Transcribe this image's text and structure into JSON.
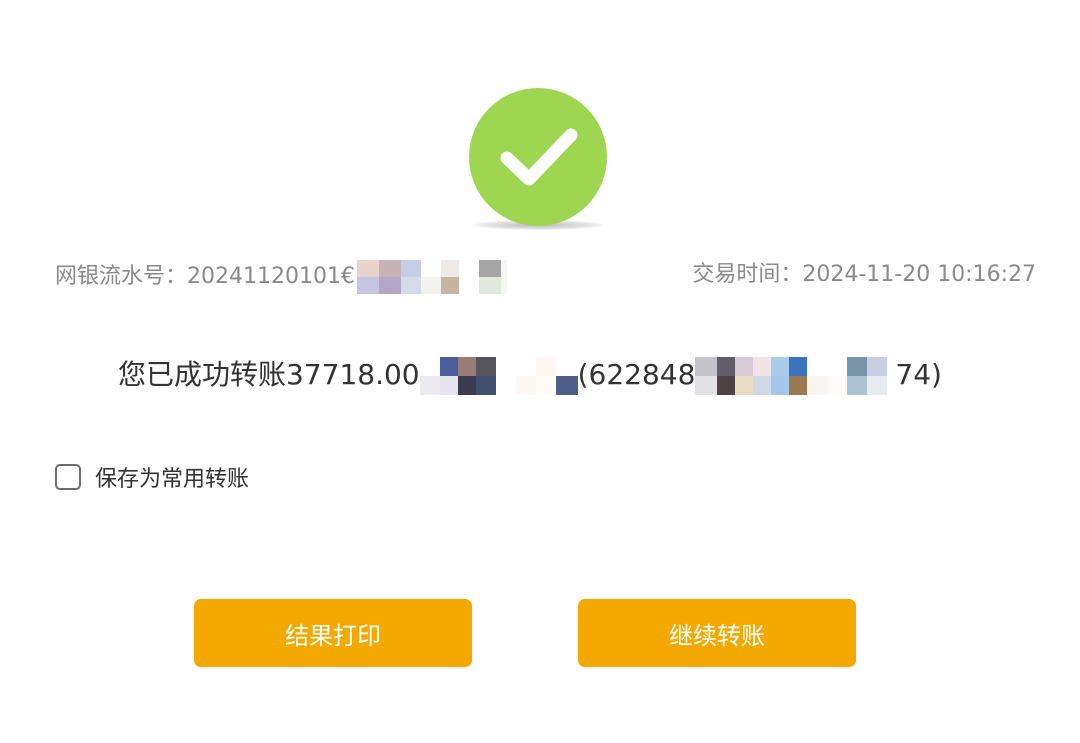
{
  "status": {
    "icon": "check-circle-icon",
    "color": "#9fd651"
  },
  "transaction": {
    "serial_label": "网银流水号：",
    "serial_visible": "20241120101€",
    "time_label": "交易时间：",
    "time_value": "2024-11-20 10:16:27"
  },
  "message": {
    "prefix": "您已成功转账37718.00",
    "recipient_open": "(622848",
    "account_tail": "74)"
  },
  "save_option": {
    "label": "保存为常用转账",
    "checked": false
  },
  "buttons": {
    "print_label": "结果打印",
    "continue_label": "继续转账"
  },
  "colors": {
    "accent": "#f4a900",
    "success": "#9fd651",
    "muted_text": "#8a8a8a",
    "body_text": "#333333"
  }
}
